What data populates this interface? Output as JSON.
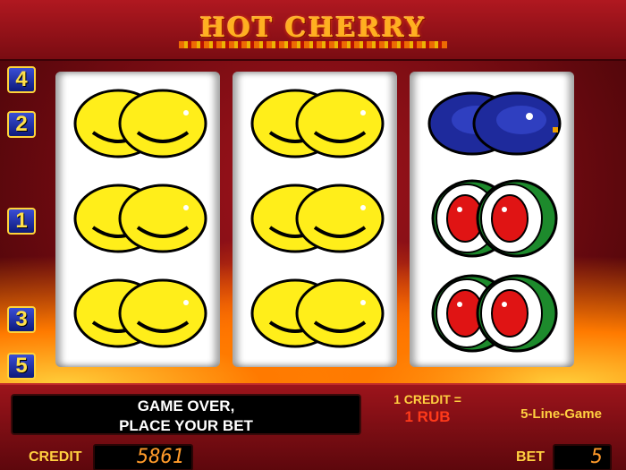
{
  "game": {
    "title": "HOT CHERRY"
  },
  "lines": {
    "badges": [
      {
        "label": "4"
      },
      {
        "label": "2"
      },
      {
        "label": "1"
      },
      {
        "label": "3"
      },
      {
        "label": "5"
      }
    ]
  },
  "reels": [
    {
      "symbols": [
        "lemon",
        "lemon",
        "lemon"
      ]
    },
    {
      "symbols": [
        "lemon",
        "lemon",
        "lemon"
      ]
    },
    {
      "symbols": [
        "plum",
        "watermelon",
        "watermelon"
      ]
    }
  ],
  "panel": {
    "message_line1": "GAME OVER,",
    "message_line2": "PLACE YOUR BET",
    "credit_rate_line1": "1 CREDIT =",
    "credit_rate_line2": "1 RUB",
    "game_mode": "5-Line-Game",
    "credit_label": "CREDIT",
    "credit_value": "5861",
    "bet_label": "BET",
    "bet_value": "5"
  },
  "colors": {
    "lemon": "#ffee1a",
    "plum": "#1e2a9c",
    "watermelon_rind": "#1d8a2c",
    "watermelon_flesh": "#e01414",
    "label_yellow": "#ffd040",
    "digital_orange": "#ff9a2a"
  }
}
